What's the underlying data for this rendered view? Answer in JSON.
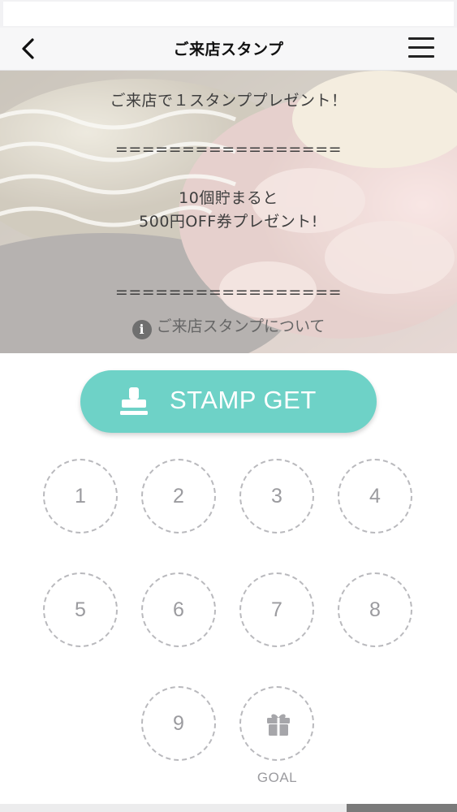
{
  "header": {
    "title": "ご来店スタンプ"
  },
  "hero": {
    "lines": [
      "ご来店で１スタンププレゼント！",
      "=================",
      "10個貯まると",
      "500円OFF券プレゼント!",
      "================="
    ],
    "info_icon": "i",
    "info_link": "ご来店スタンプについて"
  },
  "stamp_button": {
    "label": "STAMP GET",
    "icon": "stamp-icon",
    "color": "#6ed2c7"
  },
  "stamp_card": {
    "slots": [
      "1",
      "2",
      "3",
      "4",
      "5",
      "6",
      "7",
      "8",
      "9"
    ],
    "goal_label": "GOAL",
    "goal_icon": "gift-icon"
  },
  "icons": {
    "back": "chevron-left-icon",
    "menu": "hamburger-menu-icon",
    "info": "info-icon"
  }
}
